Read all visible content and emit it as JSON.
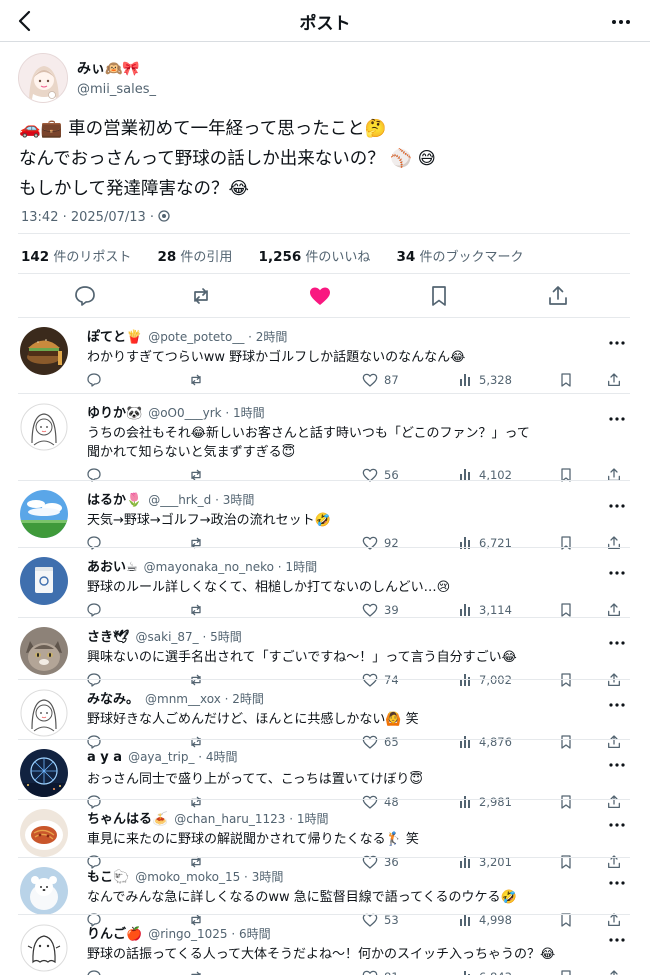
{
  "header": {
    "title": "ポスト"
  },
  "post": {
    "author": {
      "name": "みぃ🙉🎀",
      "handle": "@mii_sales_"
    },
    "lines": [
      "🚗💼 車の営業初めて一年経って思ったこと🤔",
      "なんでおっさんって野球の話しか出来ないの？ ⚾ 😅",
      "もしかして発達障害なの？😂"
    ],
    "time": "13:42 · 2025/07/13 · ",
    "stats": [
      {
        "num": "142",
        "label": " 件のリポスト"
      },
      {
        "num": "28",
        "label": " 件の引用"
      },
      {
        "num": "1,256",
        "label": " 件のいいね"
      },
      {
        "num": "34",
        "label": " 件のブックマーク"
      }
    ]
  },
  "colors": {
    "like_active": "#f91880",
    "icon_gray": "#536471",
    "text": "#0f1419"
  },
  "replies": [
    {
      "avatar": "burger",
      "name": "ぽてと🍟",
      "handle": "@pote_poteto__ · 2時間",
      "lines": [
        "わかりすぎてつらいww 野球かゴルフしか話題ないのなんなん😂"
      ],
      "likes": "87",
      "views": "5,328"
    },
    {
      "avatar": "girl-sketch",
      "name": "ゆりか🐼",
      "handle": "@oO0___yrk · 1時間",
      "lines": [
        "うちの会社もそれ😂新しいお客さんと話す時いつも「どこのファン？」って",
        "聞かれて知らないと気まずすぎる😇"
      ],
      "likes": "56",
      "views": "4,102"
    },
    {
      "avatar": "sky",
      "name": "はるか🌷",
      "handle": "@___hrk_d · 3時間",
      "lines": [
        "天気→野球→ゴルフ→政治の流れセット🤣"
      ],
      "likes": "92",
      "views": "6,721"
    },
    {
      "avatar": "cup",
      "name": "あおい☕",
      "handle": "@mayonaka_no_neko · 1時間",
      "lines": [
        "野球のルール詳しくなくて、相槌しか打てないのしんどい…😢"
      ],
      "likes": "39",
      "views": "3,114"
    },
    {
      "avatar": "cat",
      "name": "さき🕊",
      "handle": "@saki_87_ · 5時間",
      "lines": [
        "興味ないのに選手名出されて「すごいですね〜！」って言う自分すごい😂"
      ],
      "likes": "74",
      "views": "7,002"
    },
    {
      "avatar": "girl-sketch",
      "name": "みなみ。",
      "handle": "@mnm__xox · 2時間",
      "lines": [
        "野球好きな人ごめんだけど、ほんとに共感しかない🙆 笑"
      ],
      "likes": "65",
      "views": "4,876"
    },
    {
      "avatar": "ferris",
      "name": "a y a",
      "handle": "@aya_trip_ · 4時間",
      "lines": [
        "おっさん同士で盛り上がってて、こっちは置いてけぼり😇"
      ],
      "likes": "48",
      "views": "2,981"
    },
    {
      "avatar": "pasta",
      "name": "ちゃんはる🍝",
      "handle": "@chan_haru_1123 · 1時間",
      "lines": [
        "車見に来たのに野球の解説聞かされて帰りたくなる🏌 笑"
      ],
      "likes": "36",
      "views": "3,201"
    },
    {
      "avatar": "plush",
      "name": "もこ🐑",
      "handle": "@moko_moko_15 · 3時間",
      "lines": [
        "なんでみんな急に詳しくなるのww 急に監督目線で語ってくるのウケる🤣"
      ],
      "likes": "53",
      "views": "4,998"
    },
    {
      "avatar": "ghost",
      "name": "りんご🍎",
      "handle": "@ringo_1025 · 6時間",
      "lines": [
        "野球の話振ってくる人って大体そうだよね〜！何かのスイッチ入っちゃうの？😂"
      ],
      "likes": "81",
      "views": "6,843"
    }
  ]
}
